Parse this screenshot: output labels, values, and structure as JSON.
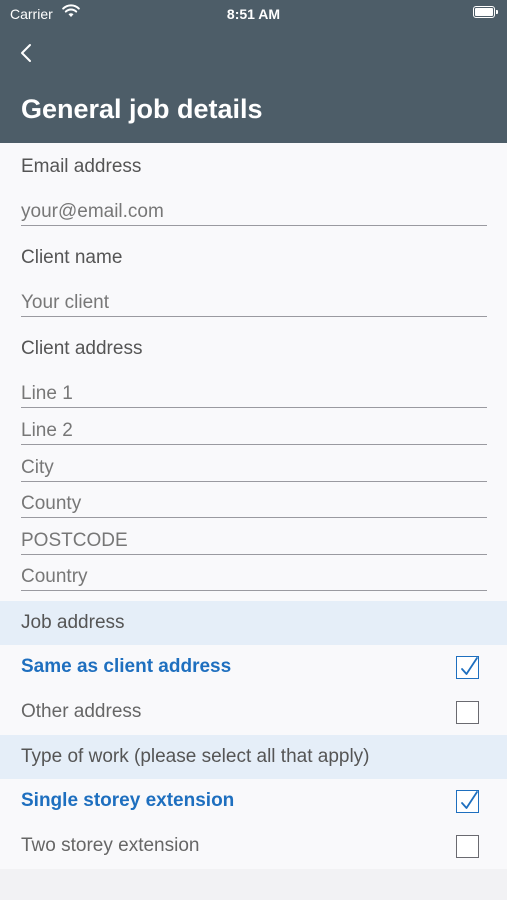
{
  "status_bar": {
    "carrier": "Carrier",
    "time": "8:51 AM"
  },
  "header": {
    "title": "General job details"
  },
  "form": {
    "email_label": "Email address",
    "email_placeholder": "your@email.com",
    "client_name_label": "Client name",
    "client_name_placeholder": "Your client",
    "client_address_label": "Client address",
    "address_lines": [
      "Line 1",
      "Line 2",
      "City",
      "County",
      "POSTCODE",
      "Country"
    ]
  },
  "job_address": {
    "header": "Job address",
    "options": [
      {
        "label": "Same as client address",
        "checked": true
      },
      {
        "label": "Other address",
        "checked": false
      }
    ]
  },
  "type_of_work": {
    "header": "Type of work (please select all that apply)",
    "options": [
      {
        "label": "Single storey extension",
        "checked": true
      },
      {
        "label": "Two storey extension",
        "checked": false
      }
    ]
  },
  "colors": {
    "header_bg": "#4d5d68",
    "accent": "#1e6fbf",
    "section_bg": "#e5eef8"
  },
  "icons": {
    "back": "chevron-left-icon",
    "wifi": "wifi-icon",
    "battery": "battery-icon",
    "check": "checkmark-icon"
  }
}
